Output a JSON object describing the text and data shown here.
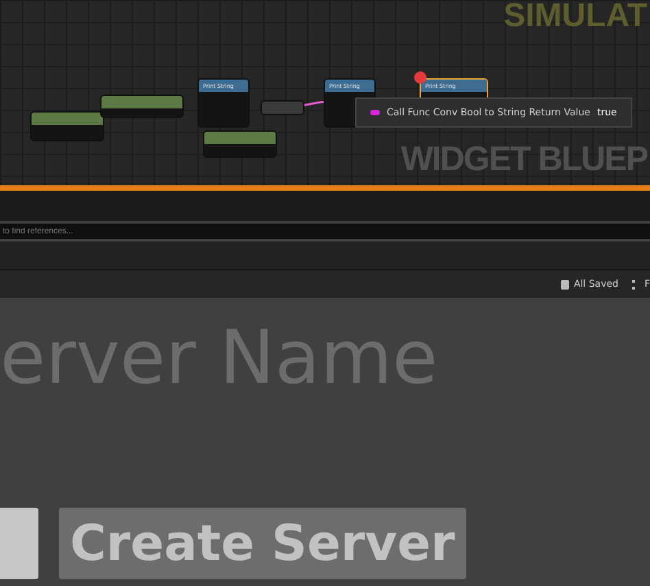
{
  "graph": {
    "watermarks": [
      "SIMULAT",
      "WIDGET BLUEP"
    ],
    "nodes": [
      {
        "color": "#5d7a45",
        "selected": false,
        "breakpoint": false
      },
      {
        "color": "#5d7a45",
        "selected": false,
        "breakpoint": false
      },
      {
        "title": "Print String",
        "color": "#3f6d92",
        "selected": false,
        "breakpoint": false
      },
      {
        "color": "#5d7a45",
        "selected": false,
        "breakpoint": false
      },
      {
        "color": "#3a3a3a",
        "selected": false,
        "breakpoint": false
      },
      {
        "title": "Print String",
        "color": "#3f6d92",
        "selected": false,
        "breakpoint": false
      },
      {
        "title": "Print String",
        "color": "#3f6d92",
        "selected": true,
        "breakpoint": true
      }
    ],
    "tooltip": {
      "label": "Call Func Conv Bool to String Return Value",
      "value": "true"
    }
  },
  "find_results": {
    "placeholder": "to find references..."
  },
  "toolbar": {
    "items": [
      {
        "label": "All Saved"
      },
      {
        "label": "F"
      }
    ]
  },
  "preview": {
    "heading": "erver Name",
    "buttons": [
      {
        "kind": "plain"
      },
      {
        "label": "Create Server",
        "kind": "text"
      }
    ]
  }
}
